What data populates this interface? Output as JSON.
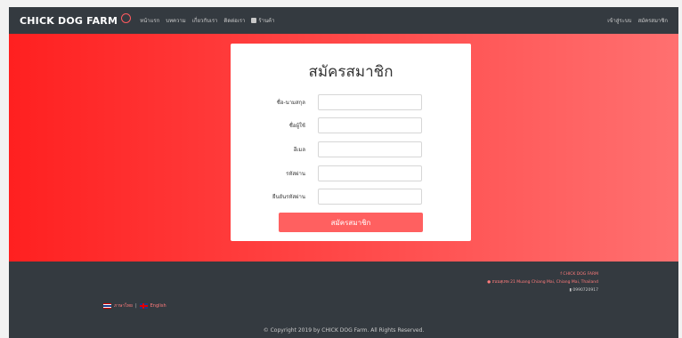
{
  "navbar": {
    "brand": "CHICK DOG FARM",
    "links": [
      "หน้าแรก",
      "บทความ",
      "เกี่ยวกับเรา",
      "ติดต่อเรา"
    ],
    "shop_label": "ร้านค้า",
    "right_links": [
      "เข้าสู่ระบบ",
      "สมัครสมาชิก"
    ]
  },
  "form": {
    "title": "สมัครสมาชิก",
    "fields": [
      {
        "label": "ชื่อ-นามสกุล",
        "value": ""
      },
      {
        "label": "ชื่อผู้ใช้",
        "value": ""
      },
      {
        "label": "อีเมล",
        "value": ""
      },
      {
        "label": "รหัสผ่าน",
        "value": ""
      },
      {
        "label": "ยืนยันรหัสผ่าน",
        "value": ""
      }
    ],
    "submit_label": "สมัครสมาชิก"
  },
  "footer": {
    "facebook": "CHICK DOG FARM",
    "address": "ถนนสุเทพ 21 Muang Chiang Mai, Chiang Mai, Thailand",
    "phone": "0990720917",
    "lang_th": "ภาษาไทย",
    "lang_sep": "|",
    "lang_en": "English",
    "copyright": "© Copyright 2019 by CHICK DOG Farm. All Rights Reserved."
  },
  "colors": {
    "accent": "#ff4c4c",
    "dark": "#343a40",
    "button": "#ff6060"
  }
}
